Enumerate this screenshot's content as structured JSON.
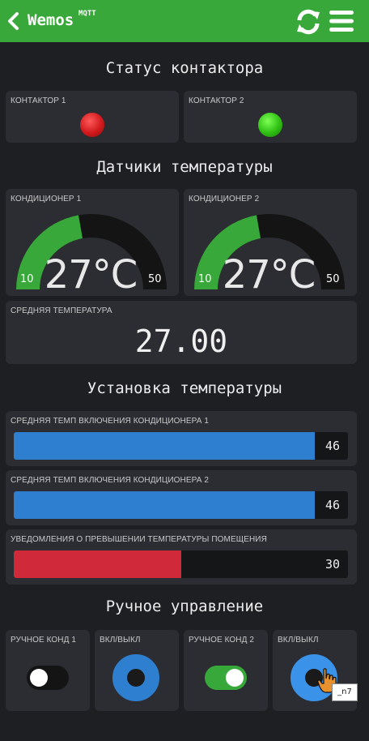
{
  "header": {
    "title": "Wemos",
    "title_sup": "MQTT",
    "back_icon": "chevron-left-icon",
    "refresh_icon": "refresh-icon",
    "menu_icon": "hamburger-menu-icon",
    "color": "#39a83a"
  },
  "contactor_section": {
    "title": "Статус контактора",
    "items": [
      {
        "label": "КОНТАКТОР 1",
        "state": "red",
        "color": "#d0191c"
      },
      {
        "label": "КОНТАКТОР 2",
        "state": "green",
        "color": "#2fbf13"
      }
    ]
  },
  "sensors_section": {
    "title": "Датчики температуры",
    "gauges": [
      {
        "label": "КОНДИЦИОНЕР 1",
        "value": "27°C",
        "min": "10",
        "max": "50",
        "level": 27
      },
      {
        "label": "КОНДИЦИОНЕР 2",
        "value": "27°C",
        "min": "10",
        "max": "50",
        "level": 27
      }
    ],
    "average": {
      "label": "СРЕДНЯЯ ТЕМПЕРАТУРА",
      "value": "27.00"
    }
  },
  "setpoints_section": {
    "title": "Установка температуры",
    "sliders": [
      {
        "label": "СРЕДНЯЯ ТЕМП ВКЛЮЧЕНИЯ КОНДИЦИОНЕРА 1",
        "value": "46",
        "fraction": 0.9,
        "color": "#2f7fd0"
      },
      {
        "label": "СРЕДНЯЯ ТЕМП ВКЛЮЧЕНИЯ КОНДИЦИОНЕРА 2",
        "value": "46",
        "fraction": 0.9,
        "color": "#2f7fd0"
      },
      {
        "label": "УВЕДОМЛЕНИЯ О ПРЕВЫШЕНИИ ТЕМПЕРАТУРЫ ПОМЕЩЕНИЯ",
        "value": "30",
        "fraction": 0.5,
        "color": "#d0293a"
      }
    ]
  },
  "manual_section": {
    "title": "Ручное управление",
    "controls": [
      {
        "label": "РУЧНОЕ КОНД 1",
        "type": "toggle",
        "on": false
      },
      {
        "label": "ВКЛ/ВЫКЛ",
        "type": "button"
      },
      {
        "label": "РУЧНОЕ КОНД 2",
        "type": "toggle",
        "on": true
      },
      {
        "label": "ВКЛ/ВЫКЛ",
        "type": "button"
      }
    ]
  },
  "tooltip": "_n7"
}
